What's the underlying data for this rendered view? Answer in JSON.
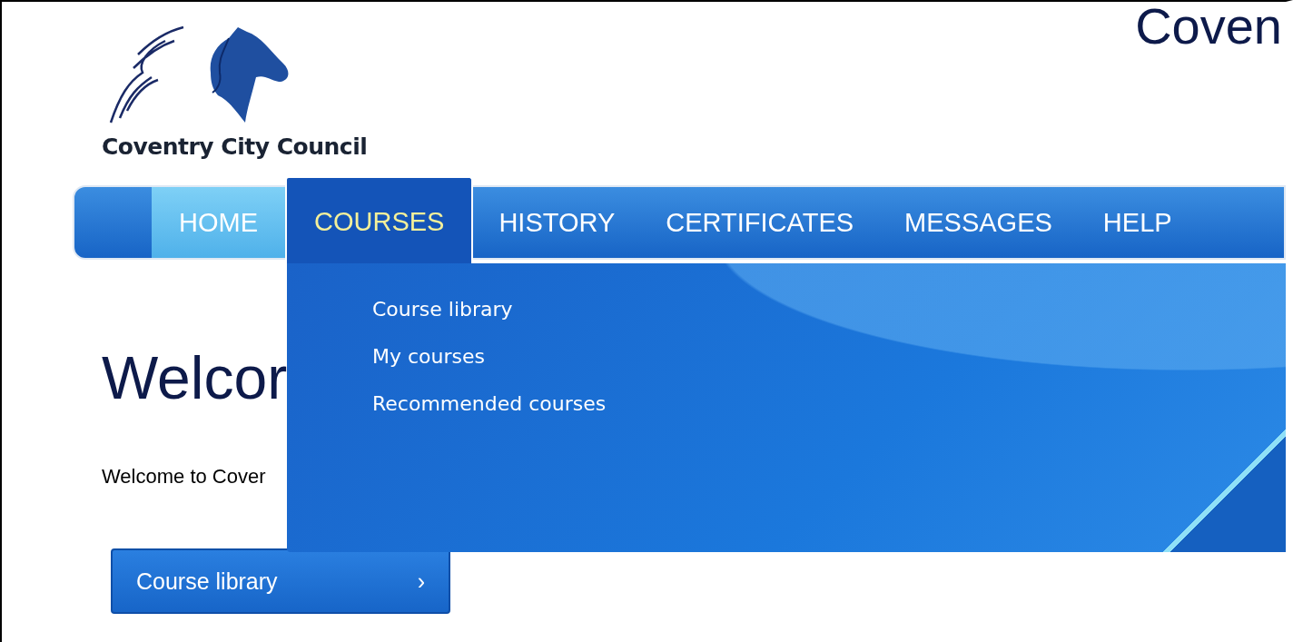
{
  "header": {
    "logo_text": "Coventry City Council",
    "site_title": "Coven"
  },
  "nav": {
    "tabs": [
      {
        "label": "HOME",
        "selected": true,
        "expanded": false
      },
      {
        "label": "COURSES",
        "selected": false,
        "expanded": true
      },
      {
        "label": "HISTORY",
        "selected": false,
        "expanded": false
      },
      {
        "label": "CERTIFICATES",
        "selected": false,
        "expanded": false
      },
      {
        "label": "MESSAGES",
        "selected": false,
        "expanded": false
      },
      {
        "label": "HELP",
        "selected": false,
        "expanded": false
      }
    ],
    "dropdown": {
      "items": [
        "Course library",
        "My courses",
        "Recommended courses"
      ]
    }
  },
  "main": {
    "heading": "Welcor",
    "intro": "Welcome to Cover",
    "button": {
      "label": "Course library",
      "icon": "›"
    }
  }
}
